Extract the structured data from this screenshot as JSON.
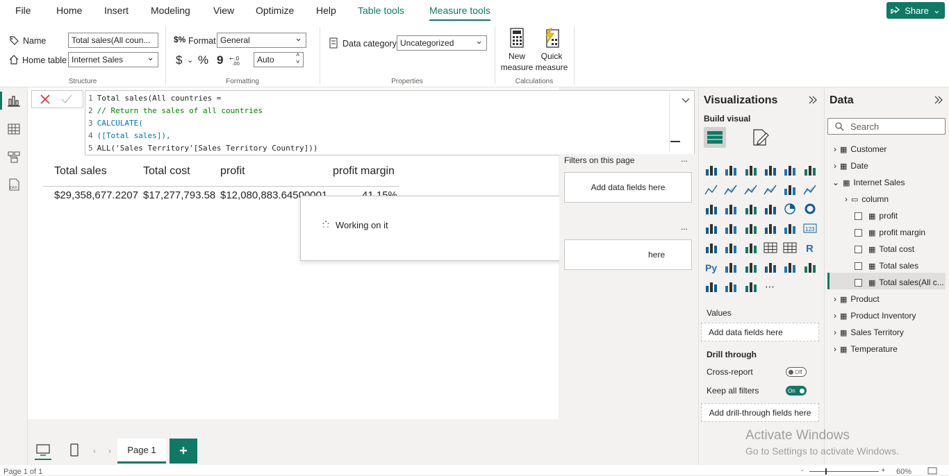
{
  "menubar": {
    "file": "File",
    "home": "Home",
    "insert": "Insert",
    "modeling": "Modeling",
    "view": "View",
    "optimize": "Optimize",
    "help": "Help",
    "table_tools": "Table tools",
    "measure_tools": "Measure tools",
    "share": "Share"
  },
  "ribbon": {
    "name_label": "Name",
    "name_value": "Total sales(All coun...",
    "home_table_label": "Home table",
    "home_table_value": "Internet Sales",
    "structure_label": "Structure",
    "format_label": "Format",
    "format_value": "General",
    "currency_symbol": "$",
    "percent_symbol": "%",
    "comma_symbol": "9",
    "decimals_value": "Auto",
    "formatting_label": "Formatting",
    "data_category_label": "Data category",
    "data_category_value": "Uncategorized",
    "properties_label": "Properties",
    "new_measure_label_1": "New",
    "new_measure_label_2": "measure",
    "quick_measure_label_1": "Quick",
    "quick_measure_label_2": "measure",
    "calculations_label": "Calculations"
  },
  "formula": {
    "lines": [
      {
        "num": "1",
        "text": "Total sales(All countries ="
      },
      {
        "num": "2",
        "text": "// Return the sales of all countries"
      },
      {
        "num": "3",
        "text": "CALCULATE("
      },
      {
        "num": "4",
        "text": "([Total sales]),"
      },
      {
        "num": "5",
        "text": "ALL('Sales Territory'[Sales Territory Country]))"
      }
    ]
  },
  "table": {
    "headers": [
      "Total sales",
      "Total cost",
      "profit",
      "profit margin"
    ],
    "row": [
      "$29,358,677.2207",
      "$17,277,793.58",
      "$12,080,883.64500001",
      "41.15%"
    ]
  },
  "popup": {
    "text": "Working on it"
  },
  "filters": {
    "on_this_page": "Filters on this page",
    "add_fields_1": "Add data fields here",
    "add_fields_2": "here",
    "more": "..."
  },
  "viz": {
    "title": "Visualizations",
    "build_visual": "Build visual",
    "values_label": "Values",
    "values_drop": "Add data fields here",
    "drill_through": "Drill through",
    "cross_report": "Cross-report",
    "cross_report_state": "Off",
    "keep_filters": "Keep all filters",
    "keep_filters_state": "On",
    "drill_drop": "Add drill-through fields here"
  },
  "data": {
    "title": "Data",
    "search_placeholder": "Search",
    "tables": [
      "Customer",
      "Date",
      "Internet Sales"
    ],
    "folder": "column",
    "fields": [
      "profit",
      "profit margin",
      "Total cost",
      "Total sales",
      "Total sales(All c..."
    ],
    "tables_after": [
      "Product",
      "Product Inventory",
      "Sales Territory",
      "Temperature"
    ]
  },
  "bottom": {
    "page_tab": "Page 1",
    "add_page": "+"
  },
  "status": {
    "page": "Page 1 of 1",
    "zoom": "60%"
  },
  "watermark": {
    "line1": "Activate Windows",
    "line2": "Go to Settings to activate Windows."
  },
  "colors": {
    "accent": "#117865"
  }
}
